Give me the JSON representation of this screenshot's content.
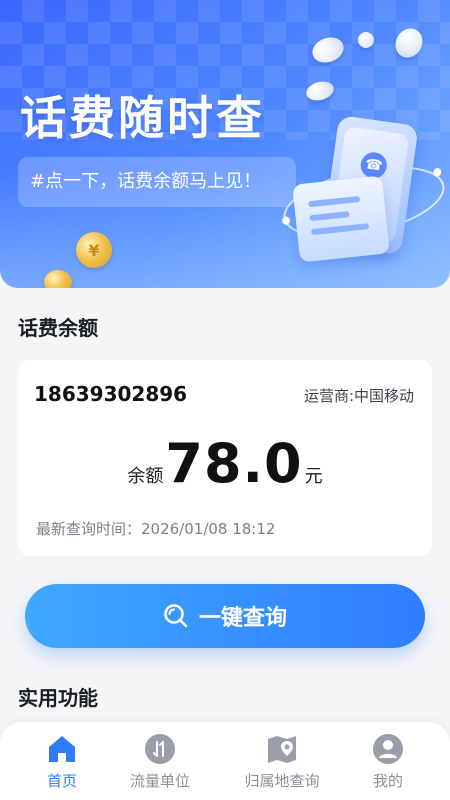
{
  "hero": {
    "title": "话费随时查",
    "subtitle": "#点一下，话费余额马上见！",
    "coin_symbol": "¥"
  },
  "balance_section": {
    "title": "话费余额",
    "phone_number": "18639302896",
    "operator": "运营商:中国移动",
    "balance_label": "余额",
    "balance_value": "78.0",
    "balance_unit": "元",
    "last_query": "最新查询时间：2026/01/08 18:12"
  },
  "query_button": {
    "label": "一键查询",
    "icon": "search-icon"
  },
  "features_section": {
    "title": "实用功能"
  },
  "bottom_nav": {
    "items": [
      {
        "label": "首页",
        "icon": "home-icon",
        "active": true
      },
      {
        "label": "流量单位",
        "icon": "data-transfer-icon",
        "active": false
      },
      {
        "label": "归属地查询",
        "icon": "map-pin-icon",
        "active": false
      },
      {
        "label": "我的",
        "icon": "user-icon",
        "active": false
      }
    ]
  },
  "colors": {
    "accent": "#2f7dff",
    "hero_blue": "#3a66ff",
    "inactive": "#8b8f99"
  }
}
